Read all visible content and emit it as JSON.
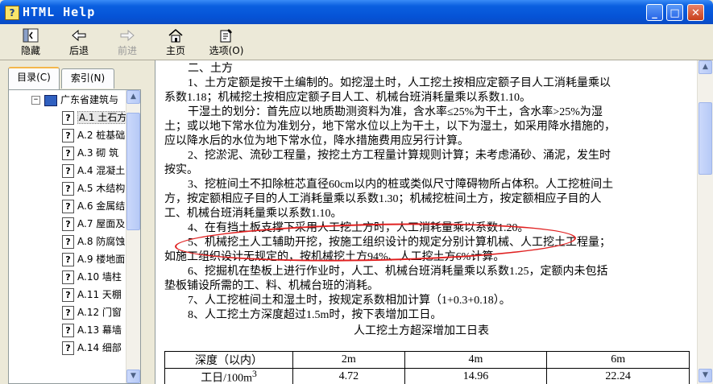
{
  "window": {
    "title": "HTML Help",
    "icon": "help-book-icon"
  },
  "toolbar": {
    "hide": "隐藏",
    "back": "后退",
    "forward": "前进",
    "home": "主页",
    "options": "选项(O)"
  },
  "tabs": {
    "contents": "目录(C)",
    "index": "索引(N)"
  },
  "tree": {
    "root": "广东省建筑与",
    "items": [
      {
        "code": "A.1",
        "label": "土石方"
      },
      {
        "code": "A.2",
        "label": "桩基础"
      },
      {
        "code": "A.3",
        "label": "砌 筑"
      },
      {
        "code": "A.4",
        "label": "混凝土"
      },
      {
        "code": "A.5",
        "label": "木结构"
      },
      {
        "code": "A.6",
        "label": "金属结"
      },
      {
        "code": "A.7",
        "label": "屋面及"
      },
      {
        "code": "A.8",
        "label": "防腐蚀"
      },
      {
        "code": "A.9",
        "label": "楼地面"
      },
      {
        "code": "A.10",
        "label": "墙柱"
      },
      {
        "code": "A.11",
        "label": "天棚"
      },
      {
        "code": "A.12",
        "label": "门窗"
      },
      {
        "code": "A.13",
        "label": "幕墙"
      },
      {
        "code": "A.14",
        "label": "细部"
      }
    ]
  },
  "doc": {
    "lines": [
      "二、土方",
      "1、土方定额是按干土编制的。如挖湿土时，人工挖土按相应定额子目人工消耗量乘以",
      "系数1.18；机械挖土按相应定额子目人工、机械台班消耗量乘以系数1.10。",
      "干湿土的划分：首先应以地质勘测资料为准，含水率≤25%为干土，含水率>25%为湿",
      "土；或以地下常水位为准划分，地下常水位以上为干土，以下为湿土，如采用降水措施的，",
      "应以降水后的水位为地下常水位，降水措施费用应另行计算。",
      "2、挖淤泥、流砂工程量，按挖土方工程量计算规则计算；未考虑涌砂、涌泥，发生时",
      "按实。",
      "3、挖桩间土不扣除桩芯直径60cm以内的桩或类似尺寸障碍物所占体积。人工挖桩间土",
      "方，按定额相应子目的人工消耗量乘以系数1.30；机械挖桩间土方，按定额相应子目的人",
      "工、机械台班消耗量乘以系数1.10。",
      "4、在有挡土板支撑下采用人工挖土方时，人工消耗量乘以系数1.20。",
      "5、机械挖土人工辅助开挖，按施工组织设计的规定分别计算机械、人工挖土工程量；",
      "如施工组织设计无规定的，按机械挖土方94%、人工挖土方6%计算。",
      "6、挖掘机在垫板上进行作业时，人工、机械台班消耗量乘以系数1.25，定额内未包括",
      "垫板铺设所需的工、料、机械台班的消耗。",
      "7、人工挖桩间土和湿土时，按规定系数相加计算（1+0.3+0.18）。",
      "8、人工挖土方深度超过1.5m时，按下表增加工日。"
    ],
    "table_caption": "人工挖土方超深增加工日表",
    "table": {
      "headers": [
        "深度（以内）",
        "2m",
        "4m",
        "6m"
      ],
      "row_label": "工日/100m",
      "row_label_sup": "3",
      "values": [
        "4.72",
        "14.96",
        "22.24"
      ]
    }
  }
}
